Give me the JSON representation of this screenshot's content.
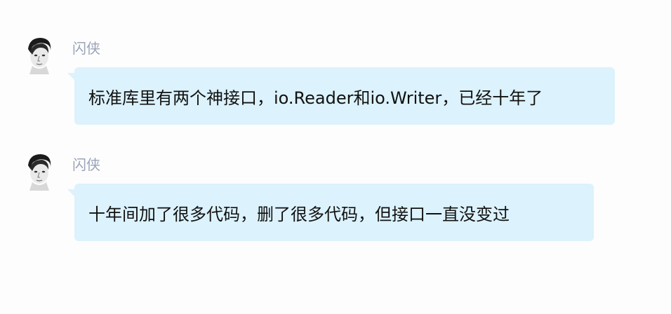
{
  "messages": [
    {
      "sender": "闪侠",
      "text": "标准库里有两个神接口，io.Reader和io.Writer，已经十年了",
      "avatar_icon": "person-portrait-icon"
    },
    {
      "sender": "闪侠",
      "text": "十年间加了很多代码，删了很多代码，但接口一直没变过",
      "avatar_icon": "person-portrait-icon"
    }
  ],
  "colors": {
    "bubble_background": "#dcf2fc",
    "sender_name": "#9aa3b8",
    "message_text": "#111111",
    "page_background": "#fdfdfd"
  }
}
